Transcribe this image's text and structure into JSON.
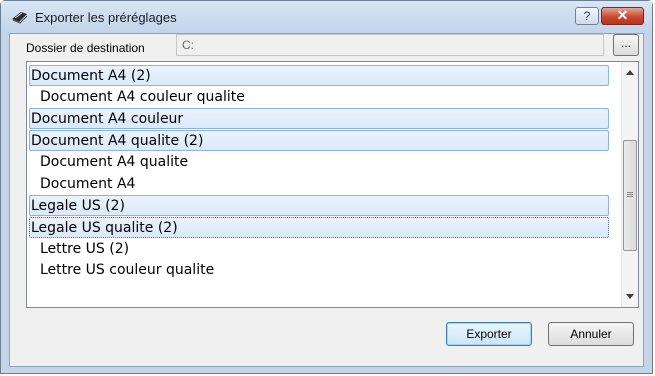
{
  "window": {
    "title": "Exporter les préréglages",
    "help_label": "?",
    "close_label": "✕"
  },
  "destination": {
    "label": "Dossier de destination",
    "value": "C:",
    "browse_label": "..."
  },
  "list": {
    "items": [
      {
        "label": "Document A4 (2)",
        "selected": true
      },
      {
        "label": "Document A4 couleur qualite",
        "selected": false
      },
      {
        "label": "Document A4 couleur",
        "selected": true
      },
      {
        "label": "Document A4 qualite (2)",
        "selected": true
      },
      {
        "label": "Document A4 qualite",
        "selected": false
      },
      {
        "label": "Document A4",
        "selected": false
      },
      {
        "label": "Legale US (2)",
        "selected": true
      },
      {
        "label": "Legale US qualite (2)",
        "selected": true,
        "focused": true
      },
      {
        "label": "Lettre US (2)",
        "selected": false
      },
      {
        "label": "Lettre US couleur qualite",
        "selected": false
      }
    ]
  },
  "buttons": {
    "export_label": "Exporter",
    "cancel_label": "Annuler"
  },
  "colors": {
    "selection_border": "#8db2e3",
    "titlebar": "#c4d5ea",
    "close_red": "#c9492f"
  }
}
